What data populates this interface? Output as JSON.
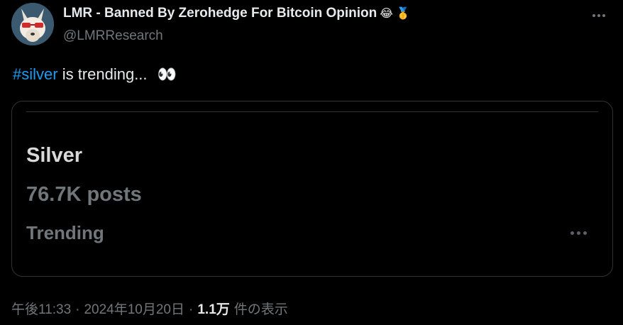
{
  "author": {
    "display_name": "LMR - Banned By Zerohedge For Bitcoin Opinion",
    "emoji_1": "😂",
    "emoji_2": "🥇",
    "handle": "@LMRResearch",
    "avatar_icon": "fox-sunglasses-avatar"
  },
  "tweet": {
    "hashtag": "#silver",
    "text": " is trending... ",
    "emoji": "👀"
  },
  "card": {
    "title": "Silver",
    "posts": "76.7K posts",
    "label": "Trending"
  },
  "meta": {
    "time": "午後11:33",
    "separator_1": "·",
    "date": "2024年10月20日",
    "separator_2": "·",
    "views": "1.1万",
    "views_suffix": "件の表示"
  },
  "colors": {
    "background": "#000000",
    "link": "#1d9bf0",
    "secondary_text": "#71767b",
    "border": "#2f3336"
  }
}
